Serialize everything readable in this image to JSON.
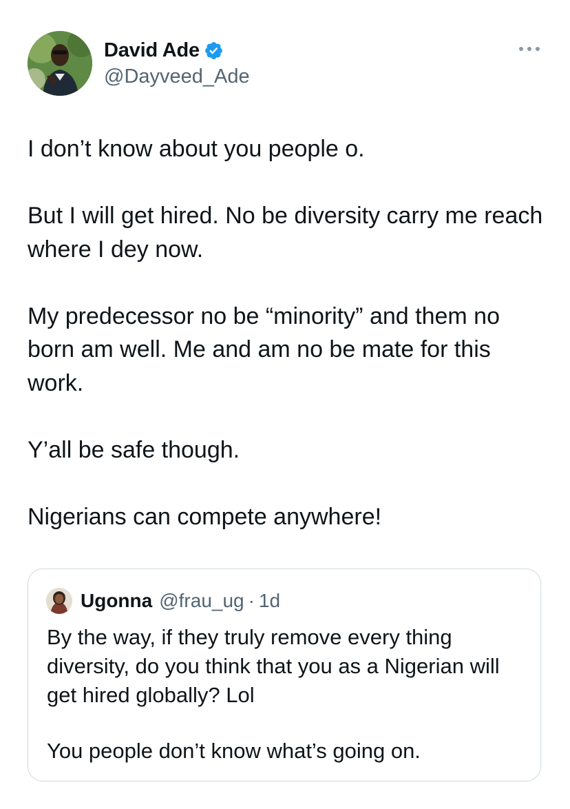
{
  "author": {
    "display_name": "David Ade",
    "handle": "@Dayveed_Ade",
    "verified_icon": "verified-badge-icon",
    "avatar_icon": "profile-photo"
  },
  "menu": {
    "icon": "more-options-icon"
  },
  "tweet": {
    "paragraphs": [
      "I don’t know about you people o.",
      "But I will get hired. No be diversity carry me reach where I dey now.",
      "My predecessor no be “minority” and them no born am well. Me and am no be mate for this work.",
      "Y’all be safe though.",
      "Nigerians can compete anywhere!"
    ]
  },
  "quoted_tweet": {
    "display_name": "Ugonna",
    "handle": "@frau_ug",
    "separator": "·",
    "time": "1d",
    "paragraphs": [
      "By the way, if they truly remove every thing diversity, do you think that you as a  Nigerian will get hired globally? Lol",
      "You people don’t know what’s going on."
    ]
  },
  "colors": {
    "text": "#0f1419",
    "secondary": "#536471",
    "verified_blue": "#1d9bf0",
    "border": "#cfd9de"
  }
}
